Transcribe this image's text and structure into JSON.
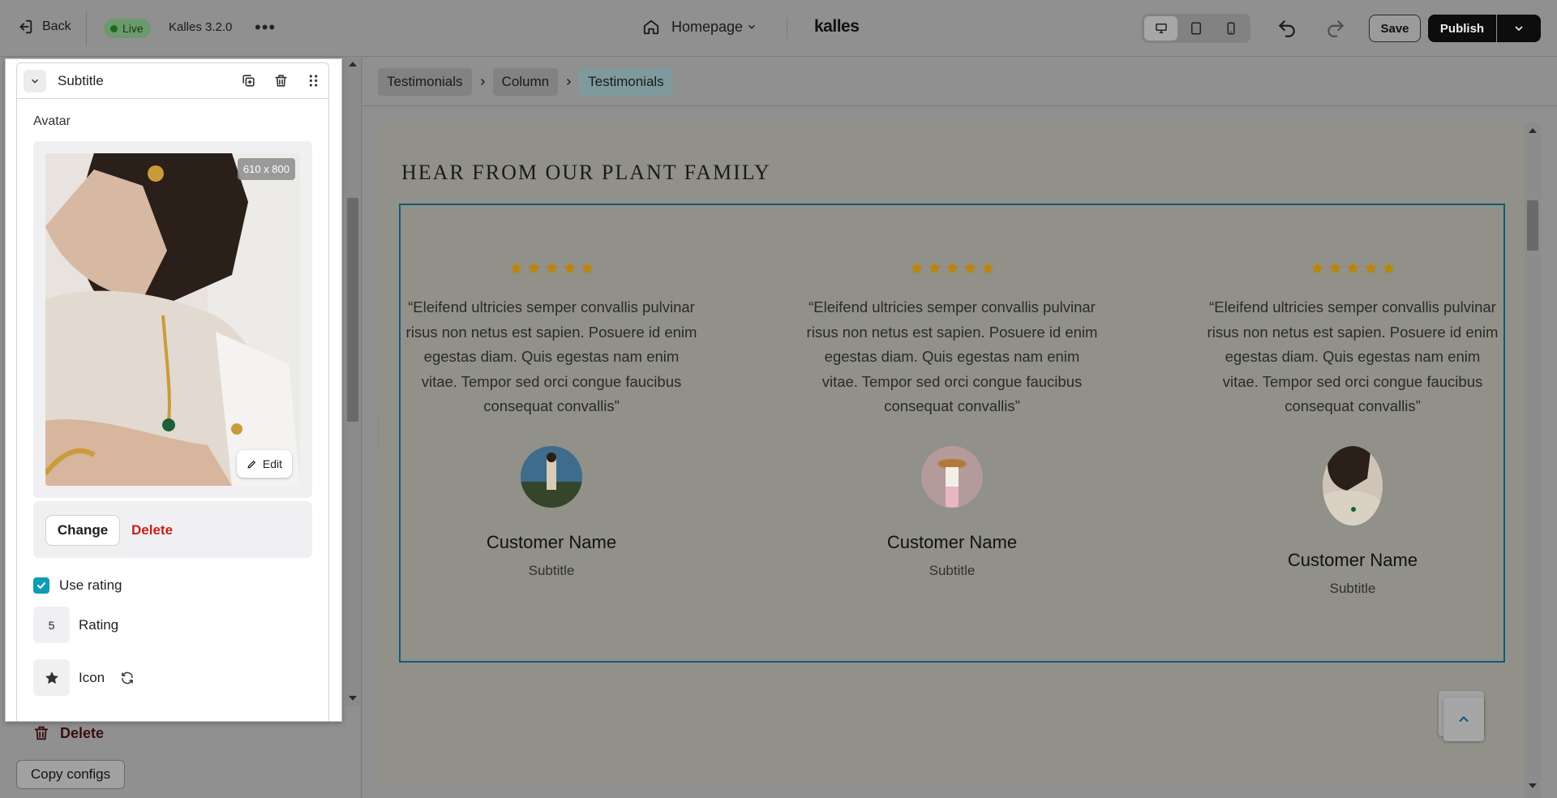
{
  "topbar": {
    "back_label": "Back",
    "live_label": "Live",
    "theme_name": "Kalles 3.2.0",
    "more_label": "•••",
    "page_label": "Homepage",
    "brand": "kalles",
    "save_label": "Save",
    "publish_label": "Publish"
  },
  "panel": {
    "title": "Subtitle",
    "avatar_label": "Avatar",
    "image_dimensions": "610 x 800",
    "edit_label": "Edit",
    "change_label": "Change",
    "delete_label": "Delete",
    "use_rating_label": "Use rating",
    "use_rating_checked": true,
    "rating_value": "5",
    "rating_label": "Rating",
    "icon_label": "Icon"
  },
  "sidebar": {
    "delete_label": "Delete",
    "copy_configs_label": "Copy configs"
  },
  "breadcrumb": [
    "Testimonials",
    "Column",
    "Testimonials"
  ],
  "preview": {
    "heading": "HEAR FROM OUR PLANT FAMILY",
    "testimonials": [
      {
        "rating": 5,
        "quote": "“Eleifend ultricies semper convallis pulvinar risus non netus est sapien. Posuere id enim egestas diam. Quis egestas nam enim vitae. Tempor sed orci congue faucibus consequat convallis”",
        "name": "Customer Name",
        "subtitle": "Subtitle"
      },
      {
        "rating": 5,
        "quote": "“Eleifend ultricies semper convallis pulvinar risus non netus est sapien. Posuere id enim egestas diam. Quis egestas nam enim vitae. Tempor sed orci congue faucibus consequat convallis”",
        "name": "Customer Name",
        "subtitle": "Subtitle"
      },
      {
        "rating": 5,
        "quote": "“Eleifend ultricies semper convallis pulvinar risus non netus est sapien. Posuere id enim egestas diam. Quis egestas nam enim vitae. Tempor sed orci congue faucibus consequat convallis”",
        "name": "Customer Name",
        "subtitle": "Subtitle"
      }
    ]
  },
  "colors": {
    "accent": "#0e9bb5",
    "selection_outline": "#0f5c78",
    "star": "#b8860b",
    "danger": "#c4201f"
  },
  "icons": {
    "back": "back-arrow-icon",
    "home": "home-icon",
    "star": "star-icon",
    "refresh": "refresh-icon"
  }
}
